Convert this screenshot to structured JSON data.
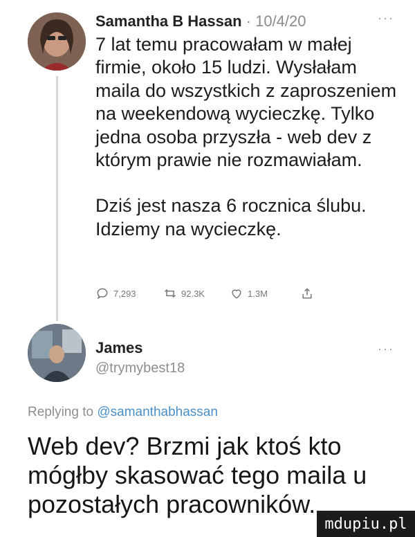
{
  "tweet": {
    "author": "Samantha B Hassan",
    "date": "· 10/4/20",
    "more": "···",
    "paragraphs": [
      "7 lat temu pracowałam w małej firmie, około 15 ludzi. Wysłałam maila do wszystkich z zaproszeniem na weekendową wycieczkę. Tylko jedna osoba przyszła - web dev z którym prawie nie rozmawiałam.",
      "Dziś jest nasza 6 rocznica ślubu. Idziemy na wycieczkę."
    ],
    "replies": "7,293",
    "retweets": "92.3K",
    "likes": "1.3M"
  },
  "reply": {
    "author": "James",
    "handle": "@trymybest18",
    "more": "···",
    "replying_prefix": "Replying to",
    "replying_to": "@samanthabhassan",
    "text": "Web dev? Brzmi jak ktoś kto mógłby skasować tego maila u pozostałych pracowników."
  },
  "watermark": "mdupiu.pl",
  "colors": {
    "link": "#4a90c8",
    "muted": "#8e8e8e",
    "text": "#1c1c1c"
  }
}
